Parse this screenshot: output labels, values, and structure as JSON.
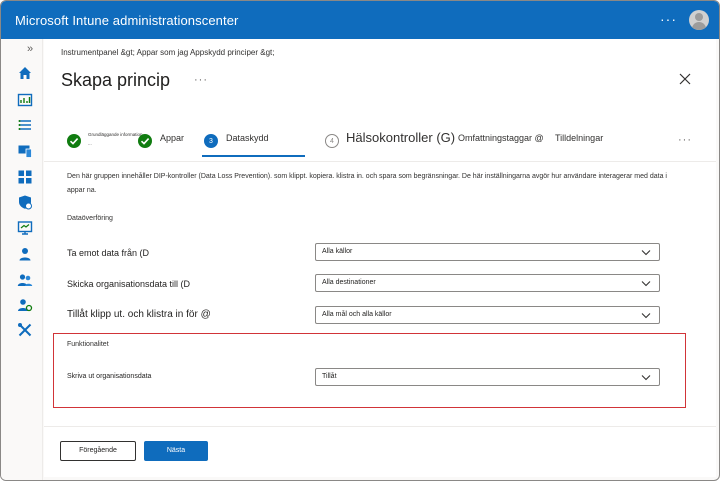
{
  "app": {
    "title": "Microsoft Intune administrationscenter"
  },
  "breadcrumb": {
    "home": "Instrumentpanel &gt;",
    "current": "Appar som jag Appskydd principer &gt;"
  },
  "page": {
    "title": "Skapa princip"
  },
  "steps": [
    {
      "label": "Grundläggande information",
      "sublabel": "...",
      "state": "done"
    },
    {
      "label": "Appar",
      "state": "done"
    },
    {
      "label": "Dataskydd",
      "number": "3",
      "state": "active"
    },
    {
      "label": "Hälsokontroller (G)",
      "number": "4",
      "state": "todo"
    },
    {
      "label": "Omfattningstaggar @",
      "state": "todo"
    },
    {
      "label": "Tilldelningar",
      "state": "todo"
    }
  ],
  "description": "Den här gruppen innehåller DIP-kontroller (Data Loss Prevention). som klippt. kopiera. klistra in. och spara som begränsningar. De här inställningarna avgör hur användare interagerar med data i appar na.",
  "sections": {
    "data_transfer": "Dataöverföring",
    "functionality": "Funktionalitet"
  },
  "fields": [
    {
      "label": "Ta emot data från (D",
      "value": "Alla källor"
    },
    {
      "label": "Skicka organisationsdata till (D",
      "value": "Alla destinationer"
    },
    {
      "label": "Tillåt klipp ut. och klistra in för @",
      "value": "Alla mål och alla källor"
    },
    {
      "label": "Skriva ut organisationsdata",
      "value": "Tillåt"
    }
  ],
  "buttons": {
    "previous": "Föregående",
    "next": "Nästa"
  },
  "colors": {
    "brand": "#0f6cbd",
    "success": "#107c10",
    "highlight": "#d13438"
  }
}
